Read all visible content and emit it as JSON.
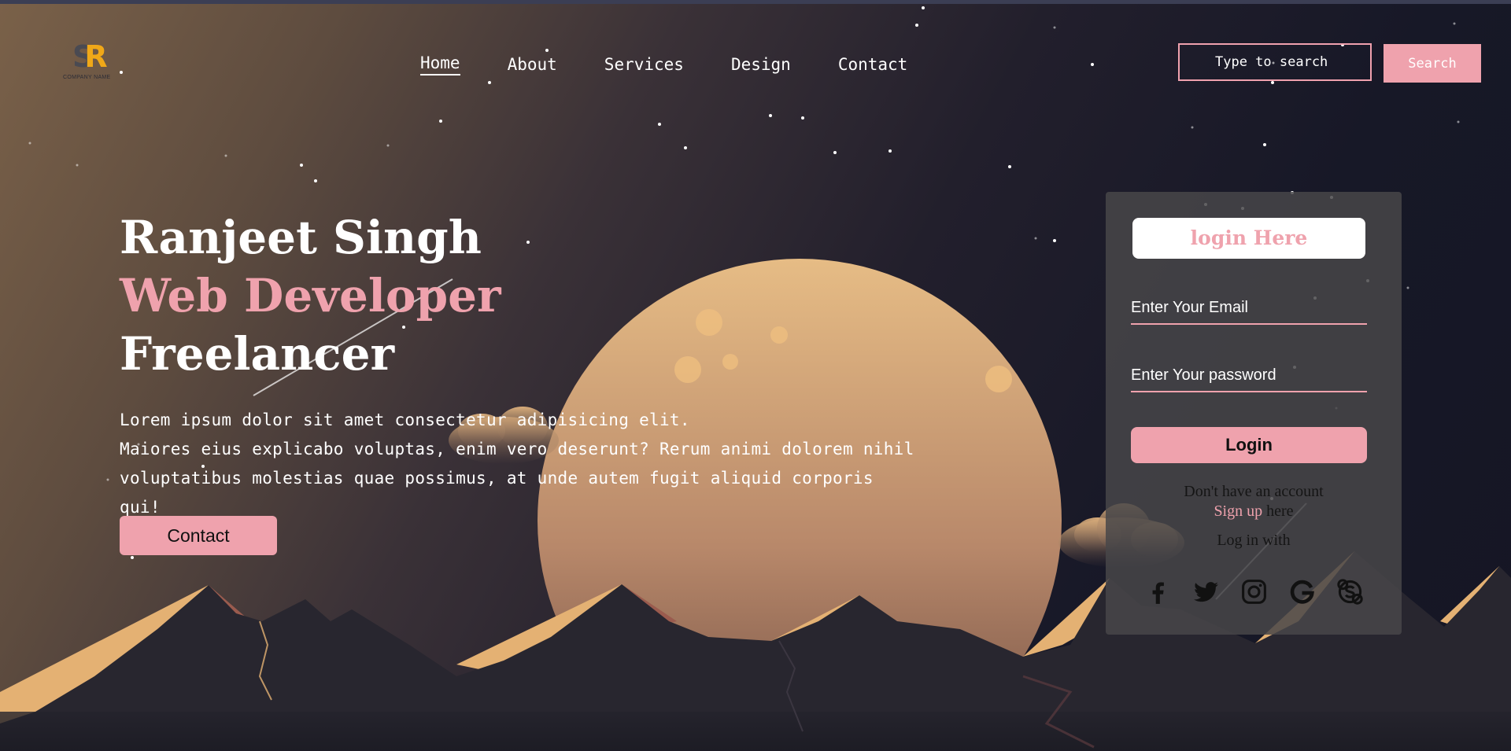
{
  "brand": {
    "logo_text": "SR",
    "company_name": "COMPANY NAME"
  },
  "nav": {
    "items": [
      {
        "label": "Home",
        "active": true
      },
      {
        "label": "About"
      },
      {
        "label": "Services"
      },
      {
        "label": "Design"
      },
      {
        "label": "Contact"
      }
    ]
  },
  "search": {
    "placeholder": "Type to search",
    "button_label": "Search"
  },
  "hero": {
    "line1": "Ranjeet Singh",
    "line2": "Web Developer",
    "line3": "Freelancer",
    "description_lines": [
      "Lorem ipsum dolor sit amet consectetur adipisicing elit.",
      "Maiores eius explicabo voluptas, enim vero deserunt? Rerum animi dolorem nihil",
      "voluptatibus molestias quae possimus, at unde autem fugit aliquid corporis qui!"
    ],
    "contact_label": "Contact"
  },
  "login": {
    "title": "login Here",
    "email_placeholder": "Enter Your Email",
    "password_placeholder": "Enter Your password",
    "button_label": "Login",
    "no_account_text": "Don't have an account",
    "signup_link": "Sign up",
    "signup_suffix": " here",
    "login_with_text": "Log in with",
    "social_icons": [
      "facebook-icon",
      "twitter-icon",
      "instagram-icon",
      "google-icon",
      "skype-icon"
    ]
  },
  "colors": {
    "accent": "#efa2ad",
    "moon": "#e2b17f",
    "mountain": "#28262f",
    "panel": "#484749"
  }
}
